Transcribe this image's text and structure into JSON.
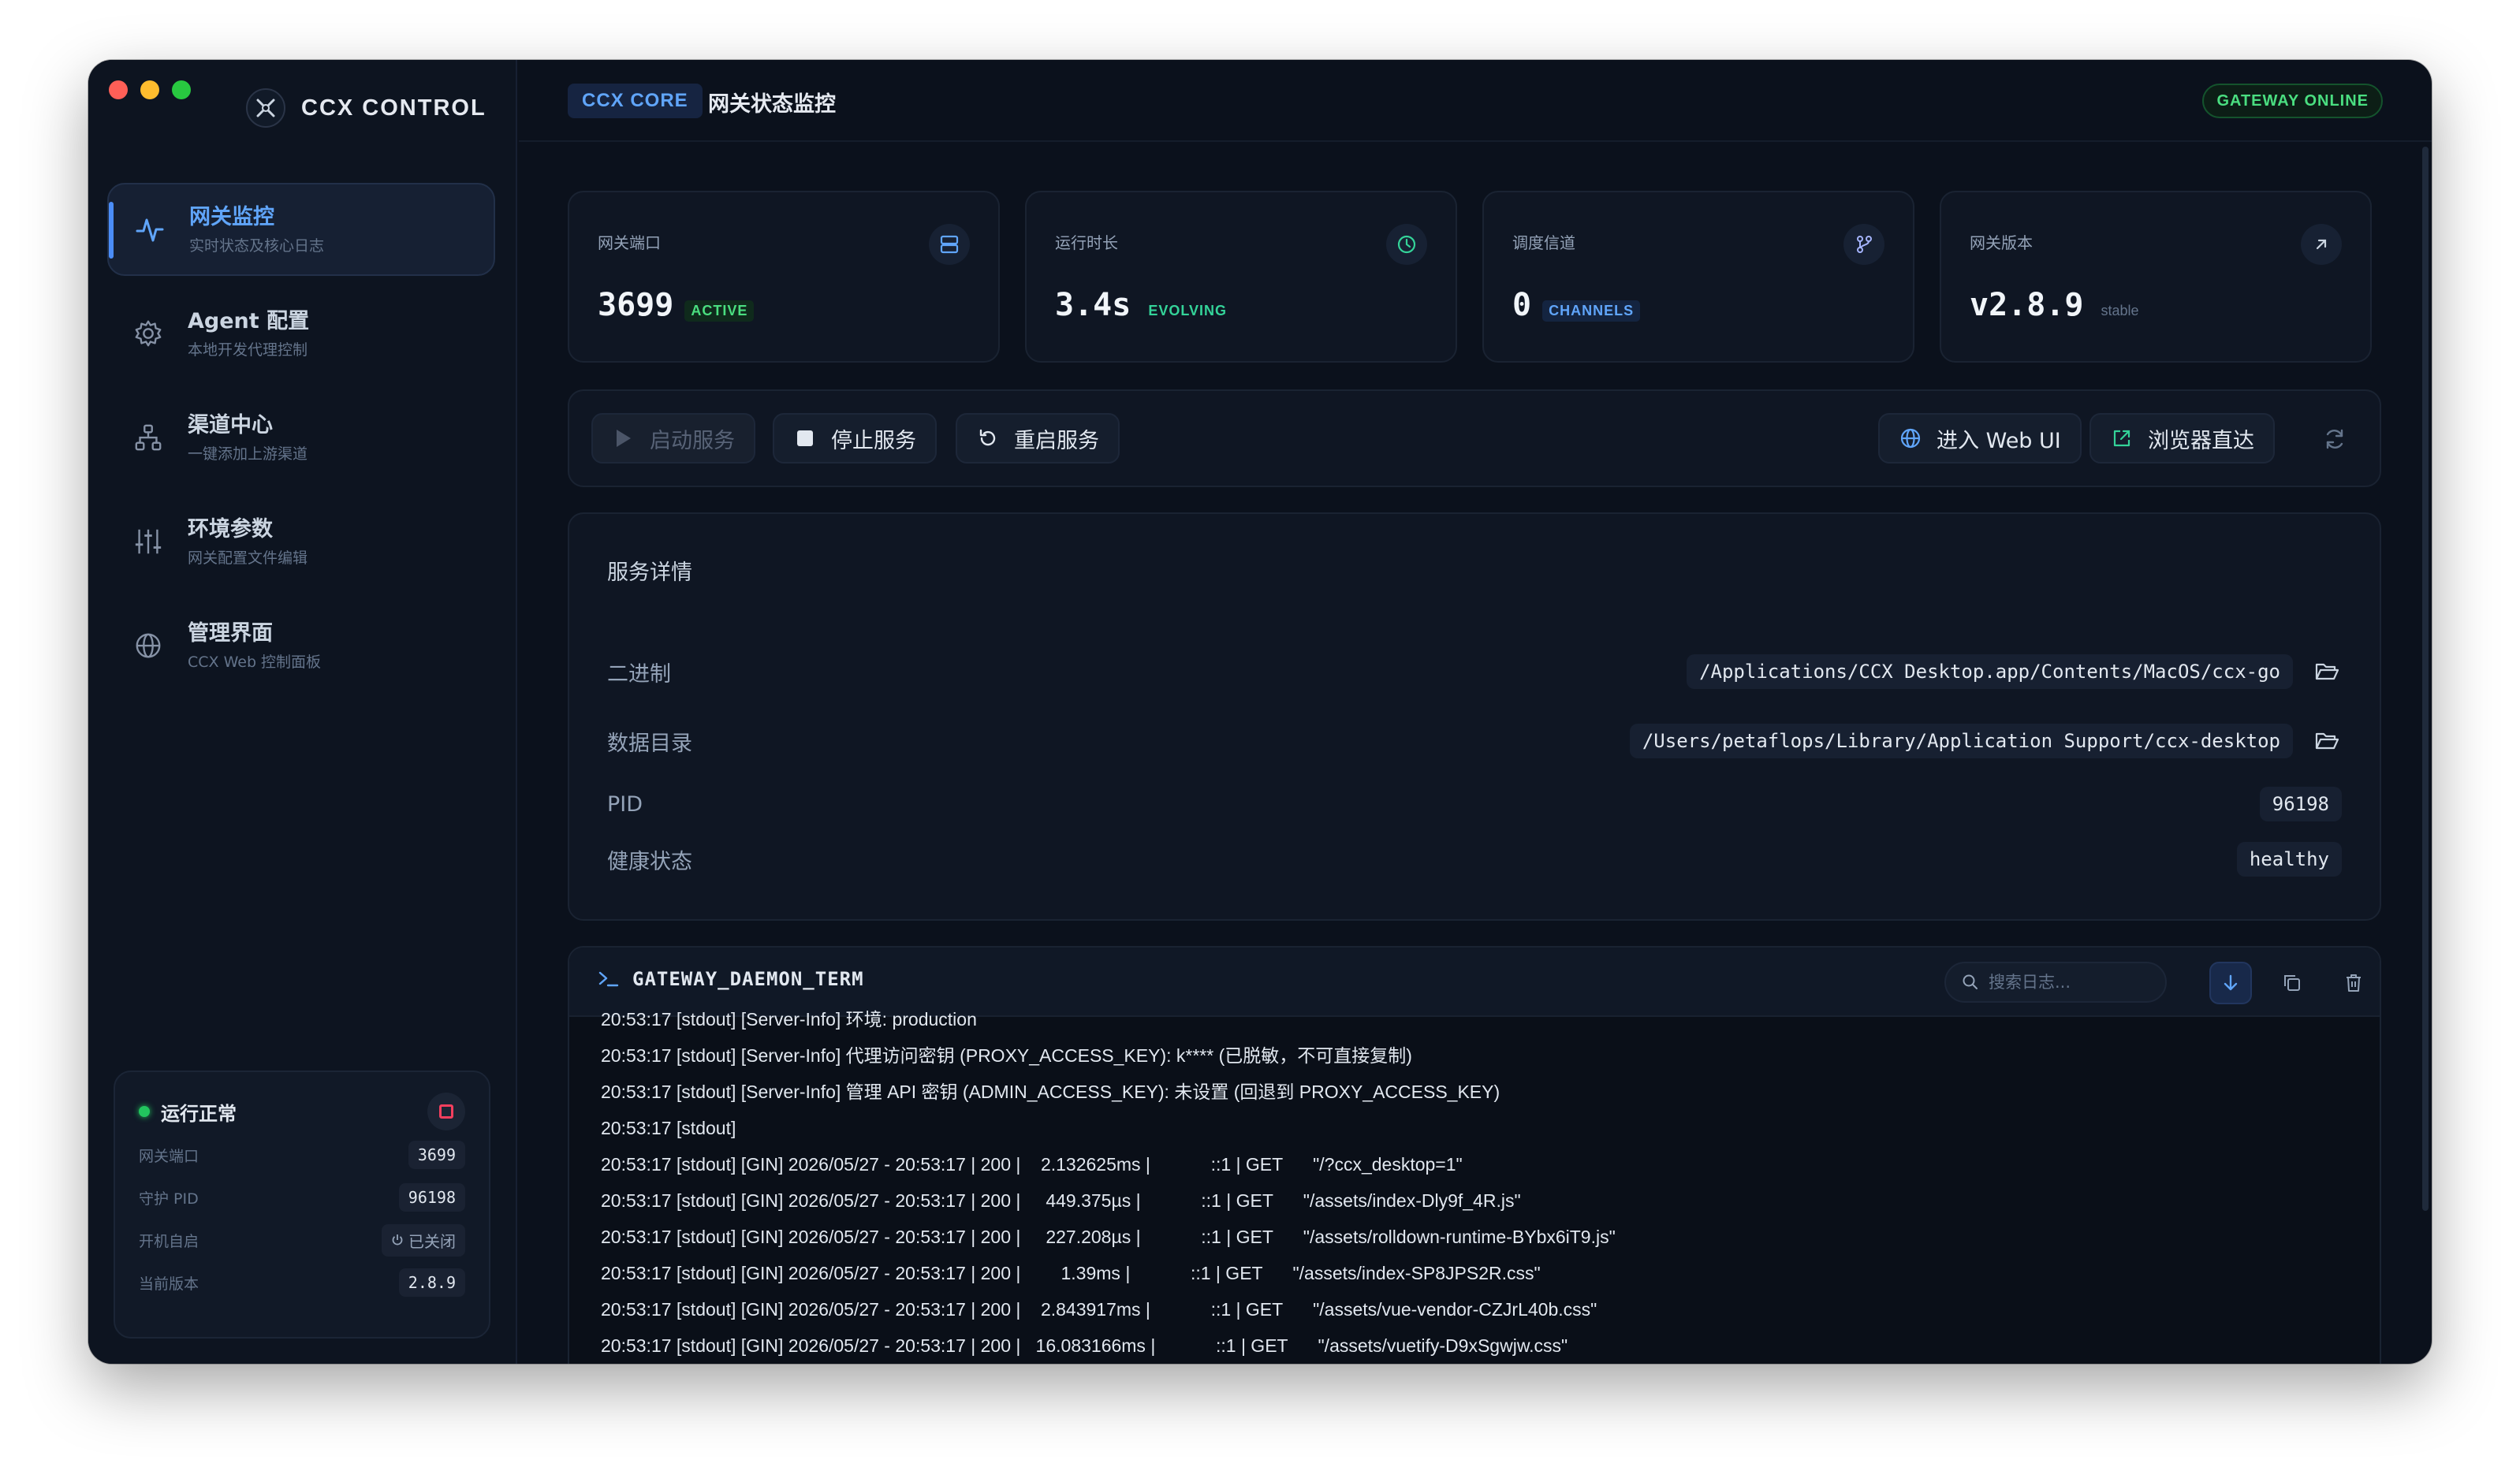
{
  "brand": {
    "title": "CCX CONTROL"
  },
  "sidebar": {
    "items": [
      {
        "title": "网关监控",
        "subtitle": "实时状态及核心日志",
        "icon": "activity-icon"
      },
      {
        "title": "Agent 配置",
        "subtitle": "本地开发代理控制",
        "icon": "gear-icon"
      },
      {
        "title": "渠道中心",
        "subtitle": "一键添加上游渠道",
        "icon": "network-icon"
      },
      {
        "title": "环境参数",
        "subtitle": "网关配置文件编辑",
        "icon": "sliders-icon"
      },
      {
        "title": "管理界面",
        "subtitle": "CCX Web 控制面板",
        "icon": "globe-icon"
      }
    ],
    "status": {
      "label": "运行正常",
      "rows": [
        {
          "key": "网关端口",
          "value": "3699"
        },
        {
          "key": "守护 PID",
          "value": "96198"
        },
        {
          "key": "开机自启",
          "value": "已关闭"
        },
        {
          "key": "当前版本",
          "value": "2.8.9"
        }
      ]
    }
  },
  "header": {
    "tag": "CCX CORE",
    "title": "网关状态监控",
    "badge": "GATEWAY ONLINE"
  },
  "stats": [
    {
      "label": "网关端口",
      "value": "3699",
      "tag": "ACTIVE",
      "icon": "server-icon"
    },
    {
      "label": "运行时长",
      "value": "3.4s",
      "tag": "EVOLVING",
      "icon": "clock-icon"
    },
    {
      "label": "调度信道",
      "value": "0",
      "tag": "CHANNELS",
      "icon": "branch-icon"
    },
    {
      "label": "网关版本",
      "value": "v2.8.9",
      "tag": "stable",
      "icon": "arrow-up-right-icon"
    }
  ],
  "actions": {
    "start": "启动服务",
    "stop": "停止服务",
    "restart": "重启服务",
    "webui": "进入 Web UI",
    "browser": "浏览器直达"
  },
  "details": {
    "title": "服务详情",
    "rows": [
      {
        "key": "二进制",
        "value": "/Applications/CCX Desktop.app/Contents/MacOS/ccx-go"
      },
      {
        "key": "数据目录",
        "value": "/Users/petaflops/Library/Application Support/ccx-desktop"
      },
      {
        "key": "PID",
        "value": "96198"
      },
      {
        "key": "健康状态",
        "value": "healthy"
      }
    ]
  },
  "terminal": {
    "title": "GATEWAY_DAEMON_TERM",
    "search_placeholder": "搜索日志...",
    "lines": [
      "20:53:17 [stdout] [Server-Info] 环境: production",
      "20:53:17 [stdout] [Server-Info] 代理访问密钥 (PROXY_ACCESS_KEY): k**** (已脱敏，不可直接复制)",
      "20:53:17 [stdout] [Server-Info] 管理 API 密钥 (ADMIN_ACCESS_KEY): 未设置 (回退到 PROXY_ACCESS_KEY)",
      "20:53:17 [stdout]",
      "20:53:17 [stdout] [GIN] 2026/05/27 - 20:53:17 | 200 |    2.132625ms |            ::1 | GET      \"/?ccx_desktop=1\"",
      "20:53:17 [stdout] [GIN] 2026/05/27 - 20:53:17 | 200 |     449.375µs |            ::1 | GET      \"/assets/index-Dly9f_4R.js\"",
      "20:53:17 [stdout] [GIN] 2026/05/27 - 20:53:17 | 200 |     227.208µs |            ::1 | GET      \"/assets/rolldown-runtime-BYbx6iT9.js\"",
      "20:53:17 [stdout] [GIN] 2026/05/27 - 20:53:17 | 200 |        1.39ms |            ::1 | GET      \"/assets/index-SP8JPS2R.css\"",
      "20:53:17 [stdout] [GIN] 2026/05/27 - 20:53:17 | 200 |    2.843917ms |            ::1 | GET      \"/assets/vue-vendor-CZJrL40b.css\"",
      "20:53:17 [stdout] [GIN] 2026/05/27 - 20:53:17 | 200 |   16.083166ms |            ::1 | GET      \"/assets/vuetify-D9xSgwjw.css\""
    ]
  },
  "colors": {
    "accent": "#4b8df8",
    "online": "#4ade80",
    "background": "#0b111c"
  }
}
